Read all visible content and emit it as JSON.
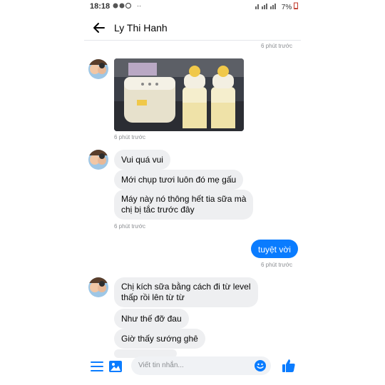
{
  "status_bar": {
    "time": "18:18",
    "battery": "7%"
  },
  "header": {
    "contact_name": "Ly Thi Hanh"
  },
  "timestamps": {
    "t1": "6 phút trước",
    "t2": "6 phút trước",
    "t3": "6 phút trước",
    "t4": "6 phút trước"
  },
  "messages": {
    "m1": "Vui quá vui",
    "m2": "Mới chụp tươi luôn đó mẹ gấu",
    "m3_line1": "Máy này nó thông hết tia sữa mà",
    "m3_line2": "chị bị tắc trước đây",
    "me1": "tuyệt vời",
    "m4_line1": "Chị kích sữa bằng cách đi từ level",
    "m4_line2": "thấp rồi lên từ từ",
    "m5": "Như thế đỡ đau",
    "m6": "Giờ thấy sướng ghê"
  },
  "composer": {
    "placeholder": "Viết tin nhắn..."
  },
  "colors": {
    "accent": "#0a7cff",
    "bubble_gray": "#eeeff1"
  },
  "icons": [
    "back-arrow-icon",
    "menu-icon",
    "image-icon",
    "emoji-icon",
    "like-icon"
  ]
}
